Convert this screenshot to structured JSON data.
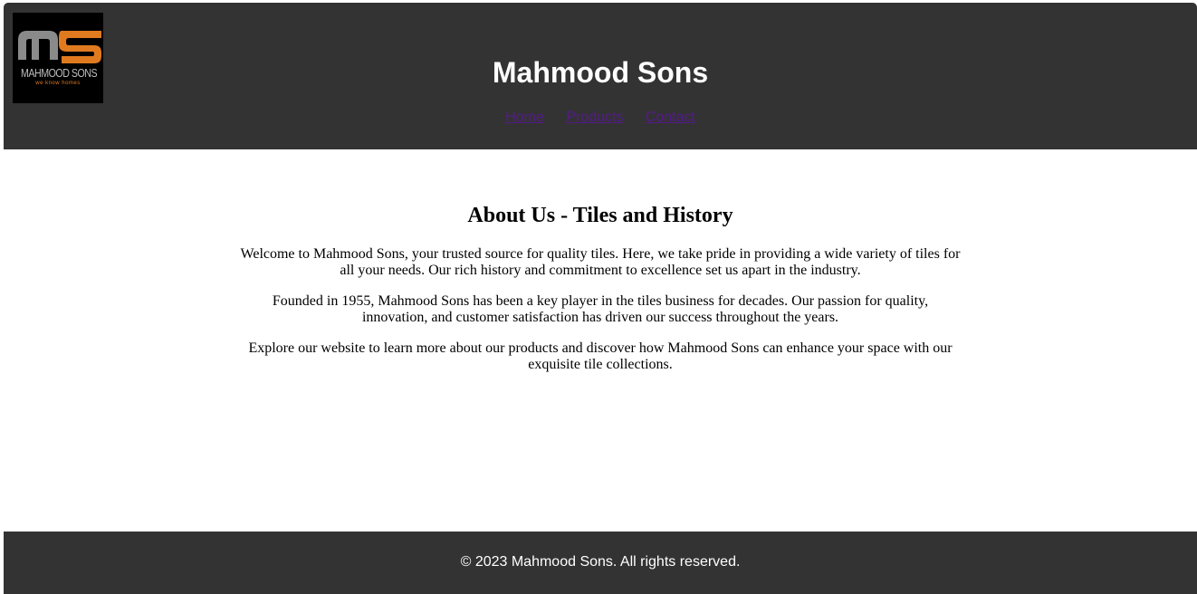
{
  "header": {
    "logo": {
      "text": "MAHMOOD SONS",
      "tagline": "we know homes",
      "icon": "ms-monogram-logo",
      "colors": {
        "gray": "#8a8a8a",
        "orange": "#e07a1f",
        "background": "#000000"
      }
    },
    "title": "Mahmood Sons",
    "nav": {
      "items": [
        {
          "label": "Home"
        },
        {
          "label": "Products"
        },
        {
          "label": "Contact"
        }
      ]
    }
  },
  "main": {
    "heading": "About Us - Tiles and History",
    "paragraphs": [
      "Welcome to Mahmood Sons, your trusted source for quality tiles. Here, we take pride in providing a wide variety of tiles for all your needs. Our rich history and commitment to excellence set us apart in the industry.",
      "Founded in 1955, Mahmood Sons has been a key player in the tiles business for decades. Our passion for quality, innovation, and customer satisfaction has driven our success throughout the years.",
      "Explore our website to learn more about our products and discover how Mahmood Sons can enhance your space with our exquisite tile collections."
    ]
  },
  "footer": {
    "copyright": "© 2023 Mahmood Sons. All rights reserved."
  },
  "colors": {
    "header_bg": "#333333",
    "footer_bg": "#333333",
    "link_visited": "#551a8b",
    "text_light": "#ffffff"
  }
}
